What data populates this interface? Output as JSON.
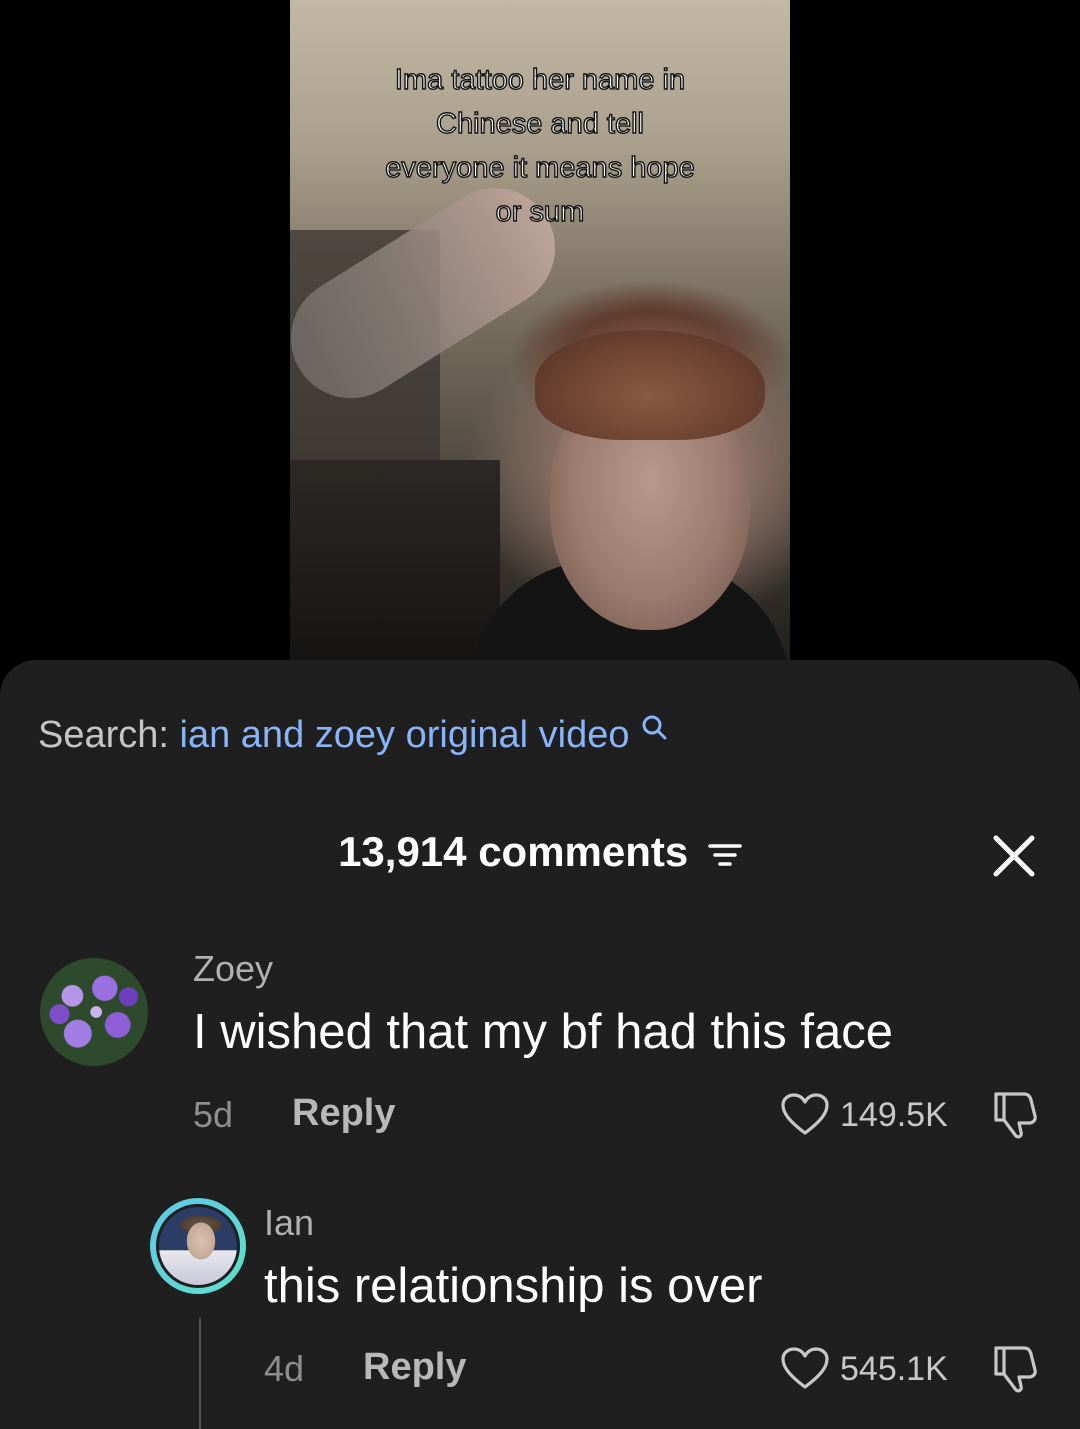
{
  "video": {
    "caption_lines": [
      "Ima tattoo her name in",
      "Chinese and tell",
      "everyone it means hope",
      "or sum"
    ]
  },
  "search": {
    "prefix": "Search:",
    "query": "ian and zoey original video",
    "icon": "search-icon"
  },
  "comments_header": {
    "count_label": "13,914 comments",
    "filter_icon": "filter-icon",
    "close_icon": "close-icon"
  },
  "comments": [
    {
      "author": "Zoey",
      "text": "I wished that my bf had this face",
      "age": "5d",
      "reply_label": "Reply",
      "likes": "149.5K",
      "avatar": "purple-flowers-avatar"
    },
    {
      "author": "Ian",
      "text": "this relationship is over",
      "age": "4d",
      "reply_label": "Reply",
      "likes": "545.1K",
      "avatar": "ian-avatar"
    }
  ],
  "colors": {
    "sheet_bg": "#1f1f1f",
    "search_query": "#8ab4f8",
    "avatar_ring": "#5fc8e8"
  }
}
